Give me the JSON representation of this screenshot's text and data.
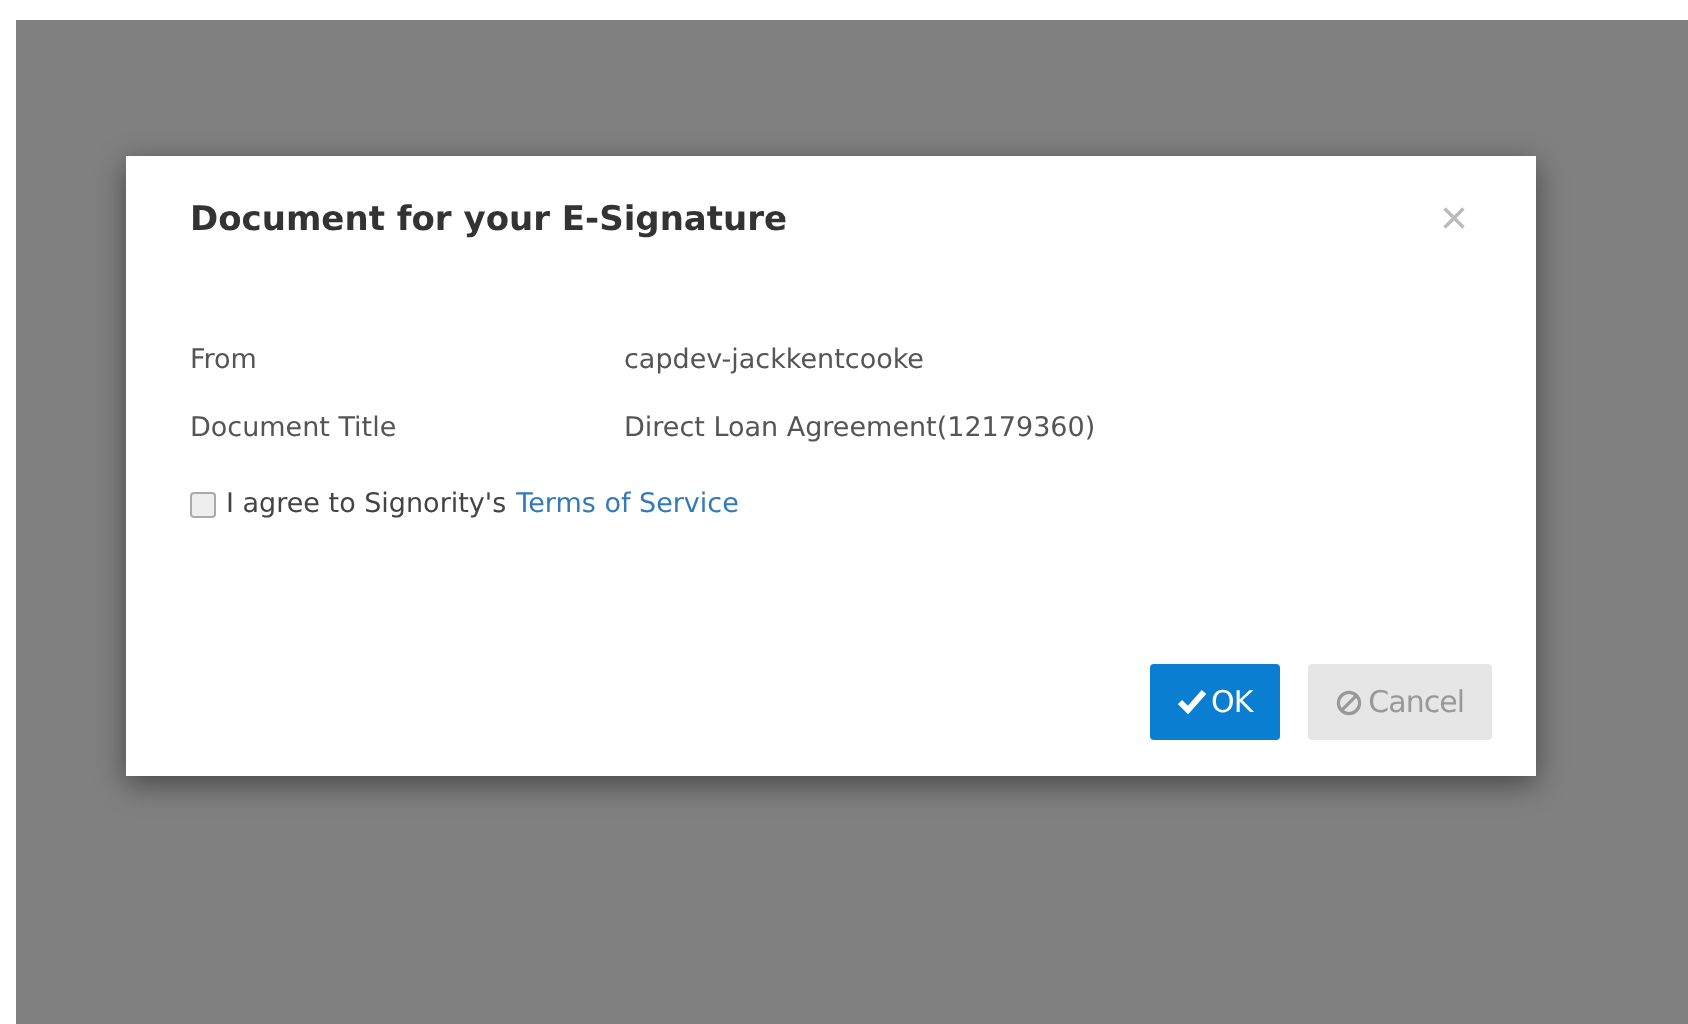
{
  "dialog": {
    "title": "Document for your E-Signature",
    "close": "×",
    "fields": [
      {
        "label": "From",
        "value": "capdev-jackkentcooke"
      },
      {
        "label": "Document Title",
        "value": "Direct Loan Agreement(12179360)"
      }
    ],
    "agreement": {
      "checked": false,
      "text": "I agree to Signority's",
      "link": "Terms of Service"
    },
    "buttons": [
      {
        "kind": "ok",
        "label": "OK",
        "disabled": false
      },
      {
        "kind": "cancel",
        "label": "Cancel",
        "disabled": true
      }
    ]
  }
}
